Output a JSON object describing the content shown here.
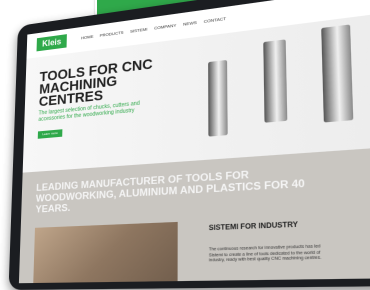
{
  "website": {
    "logo": "Kleis",
    "nav": [
      "Home",
      "Products",
      "Sistemi",
      "Company",
      "News",
      "Contact"
    ],
    "hero": {
      "title": "TOOLS FOR CNC MACHINING CENTRES",
      "subtitle": "The largest selection of chucks, cutters and accessories for the woodworking industry",
      "button": "Learn more"
    },
    "band": {
      "title": "LEADING MANUFACTURER OF TOOLS FOR WOODWORKING, ALUMINIUM AND PLASTICS FOR 40 YEARS.",
      "section_title": "SISTEMI FOR INDUSTRY",
      "section_text": "The continuous research for innovative products has led Sistemi to create a line of tools dedicated to the world of industry, ready with best quality CNC machining centres."
    }
  },
  "colors": {
    "brand": "#2fa94a",
    "bezel": "#1b1d21"
  }
}
